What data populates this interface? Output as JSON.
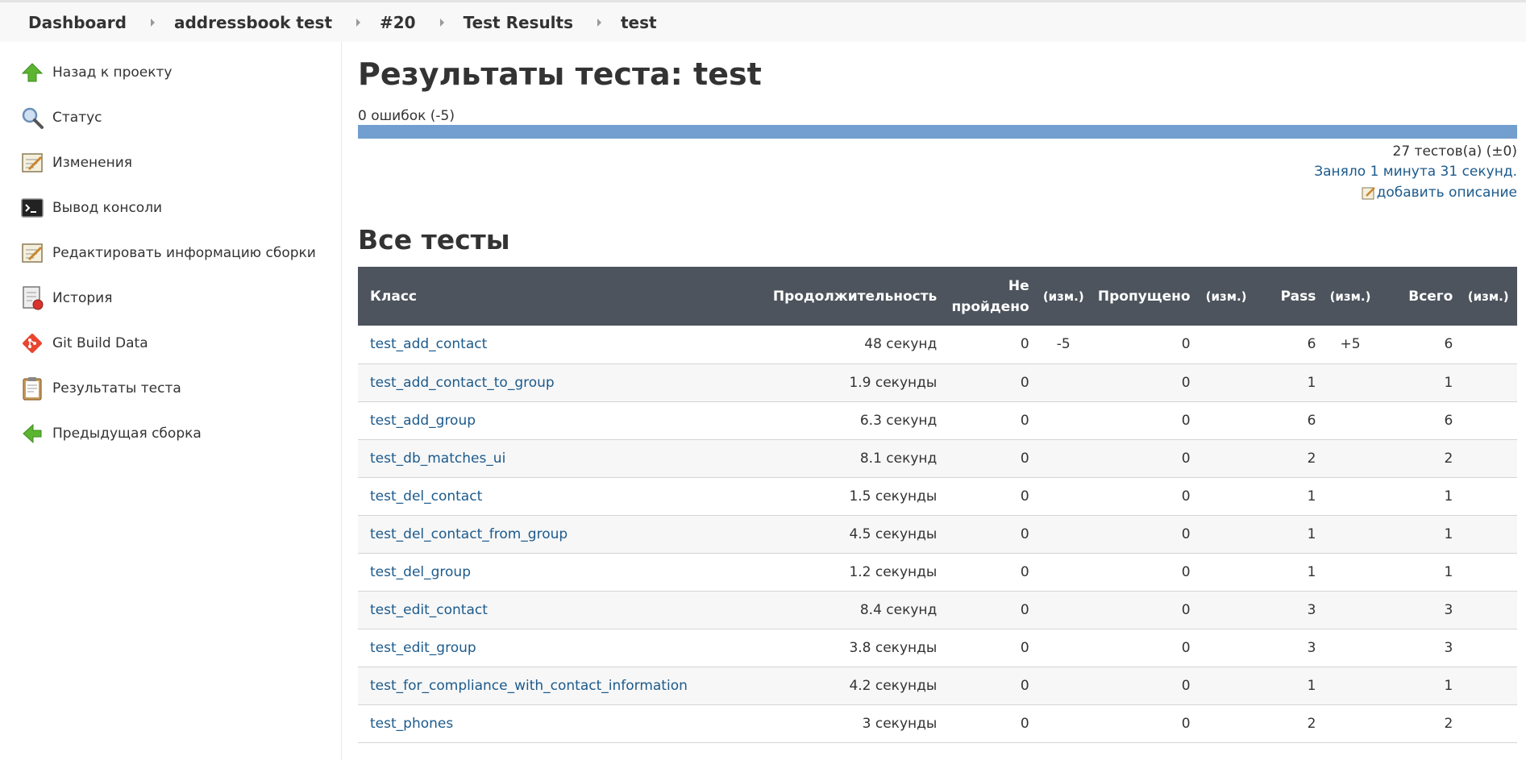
{
  "breadcrumbs": [
    "Dashboard",
    "addressbook test",
    "#20",
    "Test Results",
    "test"
  ],
  "sidebar": {
    "items": [
      {
        "label": "Назад к проекту",
        "icon": "up-arrow-icon"
      },
      {
        "label": "Статус",
        "icon": "magnifier-icon"
      },
      {
        "label": "Изменения",
        "icon": "notepad-icon"
      },
      {
        "label": "Вывод консоли",
        "icon": "terminal-icon"
      },
      {
        "label": "Редактировать информацию сборки",
        "icon": "notepad-icon"
      },
      {
        "label": "История",
        "icon": "history-icon"
      },
      {
        "label": "Git Build Data",
        "icon": "git-icon"
      },
      {
        "label": "Результаты теста",
        "icon": "clipboard-icon"
      },
      {
        "label": "Предыдущая сборка",
        "icon": "left-arrow-icon"
      }
    ]
  },
  "main": {
    "title": "Результаты теста: test",
    "fail_summary": "0 ошибок (-5)",
    "pass_fraction": 1.0,
    "tests_count": "27 тестов(а) (±0)",
    "duration_link": "Заняло 1 минута 31 секунд.",
    "add_description": "добавить описание",
    "section_title": "Все тесты"
  },
  "table": {
    "headers": {
      "class": "Класс",
      "duration": "Продолжительность",
      "failed_1": "Не",
      "failed_2": "пройдено",
      "change1": "(изм.)",
      "skipped": "Пропущено",
      "change2": "(изм.)",
      "pass": "Pass",
      "change3": "(изм.)",
      "total": "Всего",
      "change4": "(изм.)"
    },
    "rows": [
      {
        "class": "test_add_contact",
        "duration": "48 секунд",
        "failed": "0",
        "failed_diff": "-5",
        "skipped": "0",
        "skipped_diff": "",
        "pass": "6",
        "pass_diff": "+5",
        "total": "6",
        "total_diff": ""
      },
      {
        "class": "test_add_contact_to_group",
        "duration": "1.9 секунды",
        "failed": "0",
        "failed_diff": "",
        "skipped": "0",
        "skipped_diff": "",
        "pass": "1",
        "pass_diff": "",
        "total": "1",
        "total_diff": ""
      },
      {
        "class": "test_add_group",
        "duration": "6.3 секунд",
        "failed": "0",
        "failed_diff": "",
        "skipped": "0",
        "skipped_diff": "",
        "pass": "6",
        "pass_diff": "",
        "total": "6",
        "total_diff": ""
      },
      {
        "class": "test_db_matches_ui",
        "duration": "8.1 секунд",
        "failed": "0",
        "failed_diff": "",
        "skipped": "0",
        "skipped_diff": "",
        "pass": "2",
        "pass_diff": "",
        "total": "2",
        "total_diff": ""
      },
      {
        "class": "test_del_contact",
        "duration": "1.5 секунды",
        "failed": "0",
        "failed_diff": "",
        "skipped": "0",
        "skipped_diff": "",
        "pass": "1",
        "pass_diff": "",
        "total": "1",
        "total_diff": ""
      },
      {
        "class": "test_del_contact_from_group",
        "duration": "4.5 секунды",
        "failed": "0",
        "failed_diff": "",
        "skipped": "0",
        "skipped_diff": "",
        "pass": "1",
        "pass_diff": "",
        "total": "1",
        "total_diff": ""
      },
      {
        "class": "test_del_group",
        "duration": "1.2 секунды",
        "failed": "0",
        "failed_diff": "",
        "skipped": "0",
        "skipped_diff": "",
        "pass": "1",
        "pass_diff": "",
        "total": "1",
        "total_diff": ""
      },
      {
        "class": "test_edit_contact",
        "duration": "8.4 секунд",
        "failed": "0",
        "failed_diff": "",
        "skipped": "0",
        "skipped_diff": "",
        "pass": "3",
        "pass_diff": "",
        "total": "3",
        "total_diff": ""
      },
      {
        "class": "test_edit_group",
        "duration": "3.8 секунды",
        "failed": "0",
        "failed_diff": "",
        "skipped": "0",
        "skipped_diff": "",
        "pass": "3",
        "pass_diff": "",
        "total": "3",
        "total_diff": ""
      },
      {
        "class": "test_for_compliance_with_contact_information",
        "duration": "4.2 секунды",
        "failed": "0",
        "failed_diff": "",
        "skipped": "0",
        "skipped_diff": "",
        "pass": "1",
        "pass_diff": "",
        "total": "1",
        "total_diff": ""
      },
      {
        "class": "test_phones",
        "duration": "3 секунды",
        "failed": "0",
        "failed_diff": "",
        "skipped": "0",
        "skipped_diff": "",
        "pass": "2",
        "pass_diff": "",
        "total": "2",
        "total_diff": ""
      }
    ]
  }
}
